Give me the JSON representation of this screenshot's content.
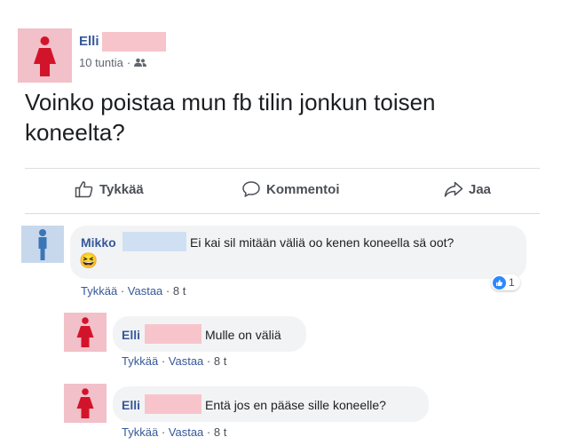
{
  "post": {
    "author": "Elli",
    "time": "10 tuntia",
    "dot": "·",
    "audience_icon": "friends-icon",
    "text_line1": "Voinko poistaa mun fb tilin jonkun toisen",
    "text_line2": "koneelta?"
  },
  "actions": {
    "like": "Tykkää",
    "comment": "Kommentoi",
    "share": "Jaa"
  },
  "comments": [
    {
      "author": "Mikko",
      "text": "Ei kai sil mitään väliä oo kenen koneella sä oot?",
      "emoji": "😆",
      "like": "Tykkää",
      "reply": "Vastaa",
      "time": "8 t",
      "reaction_count": "1"
    },
    {
      "author": "Elli",
      "text": "Mulle on väliä",
      "like": "Tykkää",
      "reply": "Vastaa",
      "time": "8 t"
    },
    {
      "author": "Elli",
      "text": "Entä jos en pääse sille koneelle?",
      "like": "Tykkää",
      "reply": "Vastaa",
      "time": "8 t"
    }
  ],
  "colors": {
    "link": "#365899",
    "like_blue": "#2d88ff",
    "avatar_female": "#f2c0c8",
    "avatar_male": "#c8d8ec",
    "redaction_pink": "#f8c4cc",
    "redaction_blue": "#cfe0f2"
  }
}
